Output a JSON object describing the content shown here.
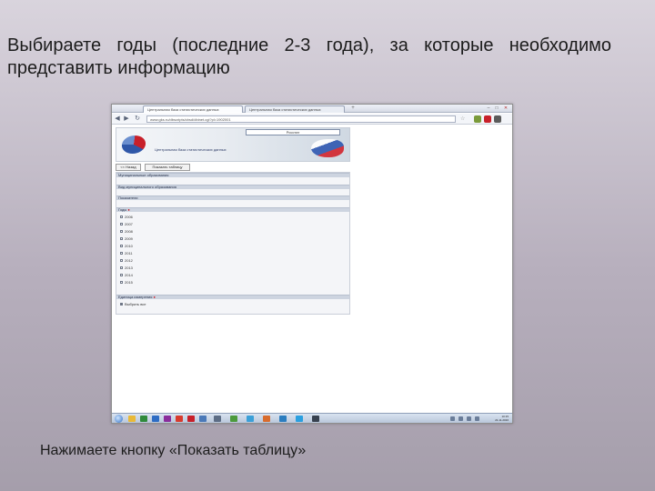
{
  "slide": {
    "title": "Выбираете годы (последние 2-3 года), за которые необходимо представить информацию",
    "caption": "Нажимаете кнопку «Показать таблицу»"
  },
  "browser": {
    "tabs": [
      "Центральная база статистических данных",
      "Центральная база статистических данных"
    ],
    "address": "www.gks.ru/dbscripts/cbsd/dbinet.cgi?pl=1902001"
  },
  "site": {
    "banner_bar": "Росстат",
    "title": "Центральная база статистических данных",
    "buttons": [
      "<< Назад",
      "Показать таблицу"
    ]
  },
  "form": {
    "sections": [
      "Муниципальные образования",
      "Вид муниципального образования",
      "Показатели",
      "Годы",
      "Единица измерения"
    ],
    "years_label": "Годы",
    "years": [
      "2006",
      "2007",
      "2008",
      "2009",
      "2010",
      "2011",
      "2012",
      "2013",
      "2014",
      "2015"
    ],
    "unit_label": "Единица измерения",
    "unit_option": "Выбрать все"
  },
  "taskbar": {
    "time": "10:15",
    "date": "21.11.2016"
  },
  "colors": {
    "brand_red": "#c8202a",
    "brand_blue": "#2f57a8",
    "section_header": "#cdd4e0"
  }
}
